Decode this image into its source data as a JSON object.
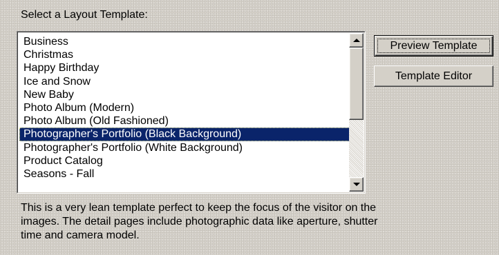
{
  "heading": "Select a Layout Template:",
  "templates": [
    "Business",
    "Christmas",
    "Happy Birthday",
    "Ice and Snow",
    "New Baby",
    "Photo Album (Modern)",
    "Photo Album (Old Fashioned)",
    "Photographer's Portfolio (Black Background)",
    "Photographer's Portfolio (White Background)",
    "Product Catalog",
    "Seasons - Fall"
  ],
  "selected_index": 7,
  "buttons": {
    "preview": "Preview Template",
    "editor": "Template Editor"
  },
  "description": "This is a very lean template perfect to keep the focus of the visitor on the images. The detail pages include photographic data like aperture, shutter time and camera model.",
  "scrollbar": {
    "up_icon": "arrow-up",
    "down_icon": "arrow-down"
  },
  "colors": {
    "dialog_bg": "#d4d0c8",
    "selection_bg": "#0a246a",
    "selection_text": "#ffffff",
    "list_bg": "#ffffff"
  }
}
